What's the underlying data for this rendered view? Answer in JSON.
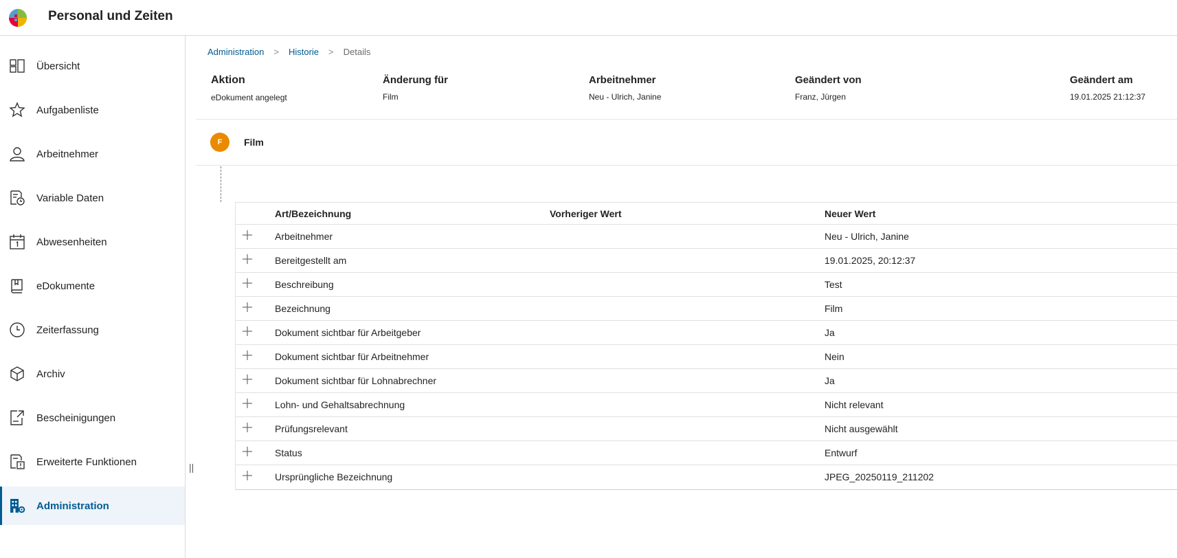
{
  "app": {
    "title": "Personal und Zeiten"
  },
  "sidebar": {
    "items": [
      {
        "label": "Übersicht",
        "icon": "dashboard-icon"
      },
      {
        "label": "Aufgabenliste",
        "icon": "star-icon"
      },
      {
        "label": "Arbeitnehmer",
        "icon": "person-icon"
      },
      {
        "label": "Variable Daten",
        "icon": "document-clock-icon"
      },
      {
        "label": "Abwesenheiten",
        "icon": "calendar-icon"
      },
      {
        "label": "eDokumente",
        "icon": "book-icon"
      },
      {
        "label": "Zeiterfassung",
        "icon": "clock-icon"
      },
      {
        "label": "Archiv",
        "icon": "box-icon"
      },
      {
        "label": "Bescheinigungen",
        "icon": "document-export-icon"
      },
      {
        "label": "Erweiterte Funktionen",
        "icon": "document-alert-icon"
      },
      {
        "label": "Administration",
        "icon": "building-gear-icon",
        "active": true
      }
    ],
    "collapse_handle": "||"
  },
  "breadcrumb": {
    "items": [
      "Administration",
      "Historie"
    ],
    "current": "Details",
    "separator": ">"
  },
  "summary": {
    "columns": [
      {
        "head": "Aktion",
        "value": "eDokument angelegt"
      },
      {
        "head": "Änderung für",
        "value": "Film"
      },
      {
        "head": "Arbeitnehmer",
        "value": "Neu - Ulrich, Janine"
      },
      {
        "head": "Geändert von",
        "value": "Franz, Jürgen"
      },
      {
        "head": "Geändert am",
        "value": "19.01.2025 21:12:37"
      }
    ]
  },
  "film": {
    "avatar_letter": "F",
    "title": "Film",
    "avatar_color": "#ea8a00"
  },
  "table": {
    "headers": [
      "Art/Bezeichnung",
      "Vorheriger Wert",
      "Neuer Wert"
    ],
    "rows": [
      {
        "name": "Arbeitnehmer",
        "old": "",
        "new": "Neu - Ulrich, Janine"
      },
      {
        "name": "Bereitgestellt am",
        "old": "",
        "new": "19.01.2025, 20:12:37"
      },
      {
        "name": "Beschreibung",
        "old": "",
        "new": "Test"
      },
      {
        "name": "Bezeichnung",
        "old": "",
        "new": "Film"
      },
      {
        "name": "Dokument sichtbar für Arbeitgeber",
        "old": "",
        "new": "Ja"
      },
      {
        "name": "Dokument sichtbar für Arbeitnehmer",
        "old": "",
        "new": "Nein"
      },
      {
        "name": "Dokument sichtbar für Lohnabrechner",
        "old": "",
        "new": "Ja"
      },
      {
        "name": "Lohn- und Gehaltsabrechnung",
        "old": "",
        "new": "Nicht relevant"
      },
      {
        "name": "Prüfungsrelevant",
        "old": "",
        "new": "Nicht ausgewählt"
      },
      {
        "name": "Status",
        "old": "",
        "new": "Entwurf"
      },
      {
        "name": "Ursprüngliche Bezeichnung",
        "old": "",
        "new": "JPEG_20250119_211202"
      }
    ]
  },
  "colors": {
    "accent": "#005b92",
    "active_bg": "#eef4f9",
    "text": "#232323"
  }
}
